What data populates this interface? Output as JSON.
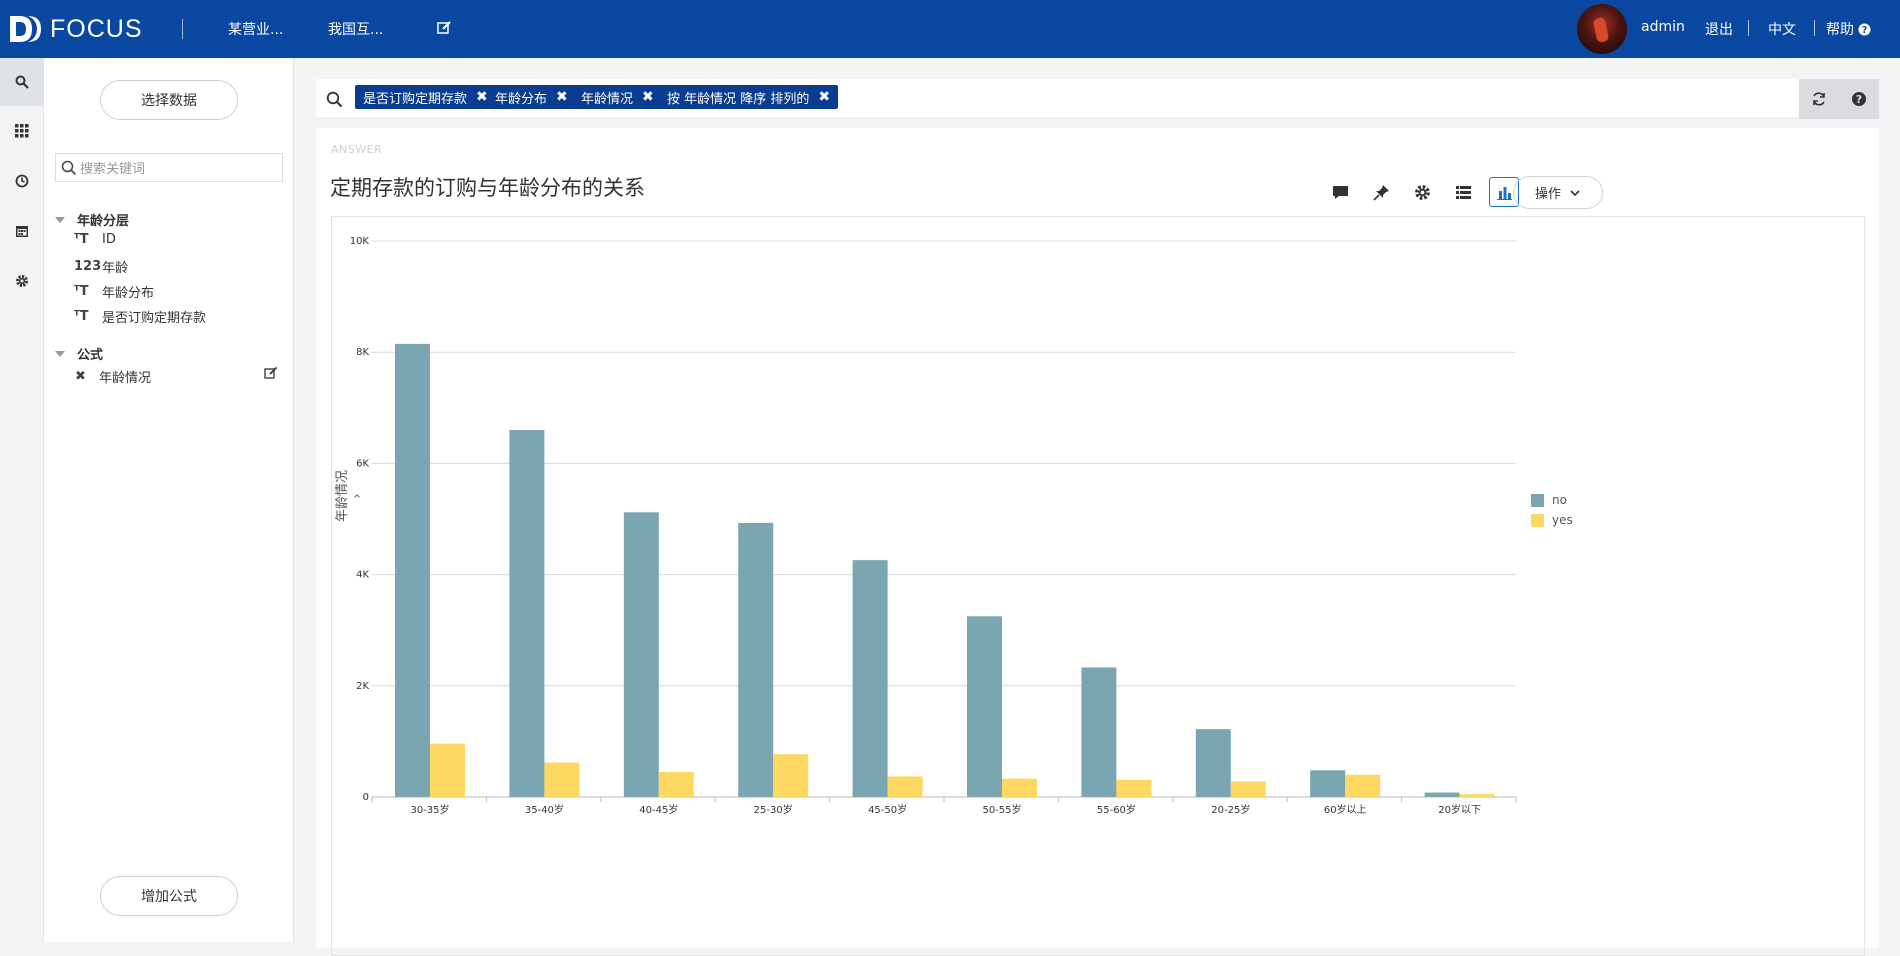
{
  "app": {
    "logo_text": "FOCUS",
    "top_links": [
      "某营业...",
      "我国互..."
    ],
    "user": "admin",
    "logout": "退出",
    "language": "中文",
    "help": "帮助"
  },
  "sidebar": {
    "select_data": "选择数据",
    "search_placeholder": "搜索关键词",
    "groups": [
      {
        "title": "年龄分层",
        "fields": [
          {
            "icon": "text",
            "label": "ID"
          },
          {
            "icon": "number",
            "icon_text": "123",
            "label": "年龄"
          },
          {
            "icon": "text",
            "label": "年龄分布"
          },
          {
            "icon": "text",
            "label": "是否订购定期存款"
          }
        ]
      },
      {
        "title": "公式",
        "fields": [
          {
            "icon": "formula",
            "label": "年龄情况"
          }
        ]
      }
    ],
    "add_formula": "增加公式"
  },
  "query": {
    "chips": [
      "是否订购定期存款",
      "年龄分布",
      "年龄情况",
      "按 年龄情况 降序 排列的"
    ]
  },
  "answer": {
    "label": "ANSWER",
    "title": "定期存款的订购与年龄分布的关系",
    "ops_label": "操作"
  },
  "chart_data": {
    "type": "bar",
    "title": "",
    "xlabel": "",
    "ylabel": "年龄情况",
    "ylim": [
      0,
      10000
    ],
    "y_ticks": [
      "0",
      "2K",
      "4K",
      "6K",
      "8K",
      "10K"
    ],
    "y_tick_values": [
      0,
      2000,
      4000,
      6000,
      8000,
      10000
    ],
    "categories": [
      "30-35岁",
      "35-40岁",
      "40-45岁",
      "25-30岁",
      "45-50岁",
      "50-55岁",
      "55-60岁",
      "20-25岁",
      "60岁以上",
      "20岁以下"
    ],
    "series": [
      {
        "name": "no",
        "color": "#7aa6b1",
        "values": [
          8150,
          6600,
          5120,
          4930,
          4260,
          3250,
          2330,
          1220,
          480,
          80
        ]
      },
      {
        "name": "yes",
        "color": "#fdd862",
        "values": [
          960,
          620,
          450,
          770,
          370,
          330,
          310,
          280,
          400,
          50
        ]
      }
    ],
    "grid": true,
    "legend_position": "right"
  }
}
